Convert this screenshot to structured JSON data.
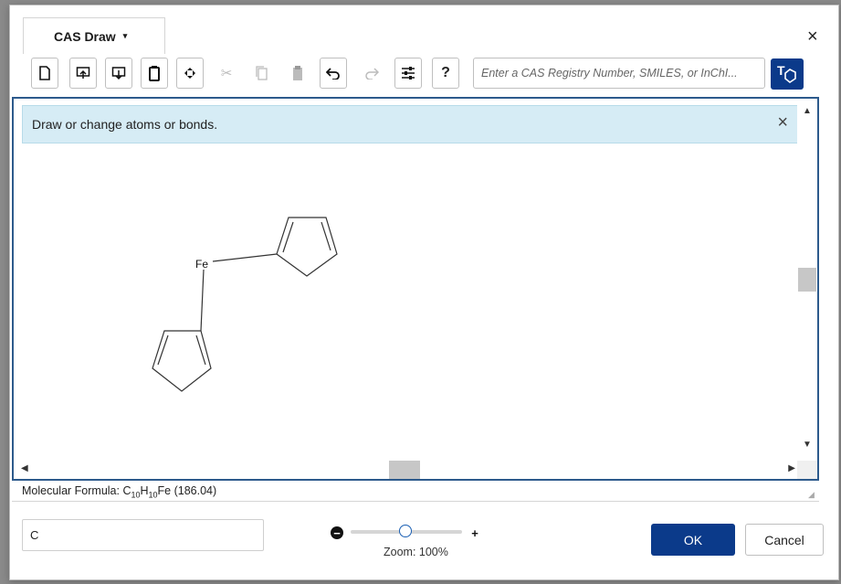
{
  "tab": {
    "label": "CAS Draw",
    "caret": "▾"
  },
  "close_glyph": "×",
  "toolbar": {
    "buttons": [
      {
        "icon": "new-document-icon",
        "glyph": "🗋",
        "disabled": false
      },
      {
        "icon": "import-icon",
        "glyph": "⇪",
        "disabled": false
      },
      {
        "icon": "export-icon",
        "glyph": "⇩",
        "disabled": false
      },
      {
        "icon": "clear-icon",
        "glyph": "▮",
        "disabled": false
      },
      {
        "icon": "select-icon",
        "glyph": "⁘",
        "disabled": false
      },
      {
        "icon": "cut-icon",
        "glyph": "✂",
        "disabled": true
      },
      {
        "icon": "copy-icon",
        "glyph": "⎘",
        "disabled": true
      },
      {
        "icon": "paste-icon",
        "glyph": "📋",
        "disabled": true
      },
      {
        "icon": "undo-icon",
        "glyph": "↶",
        "disabled": false
      },
      {
        "icon": "redo-icon",
        "glyph": "↷",
        "disabled": true
      },
      {
        "icon": "settings-icon",
        "glyph": "☰",
        "disabled": false
      },
      {
        "icon": "help-icon",
        "glyph": "?",
        "disabled": false
      }
    ],
    "search_placeholder": "Enter a CAS Registry Number, SMILES, or InChI...",
    "text_tool_label": "T"
  },
  "banner": {
    "message": "Draw or change atoms or bonds.",
    "close_glyph": "×"
  },
  "structure": {
    "atom_label": "Fe"
  },
  "formula": {
    "prefix": "Molecular Formula: C",
    "c_count": "10",
    "h": "H",
    "h_count": "10",
    "suffix": "Fe (186.04)"
  },
  "bottom": {
    "input_value": "C",
    "zoom_label": "Zoom: 100%",
    "zoom_level": 0.5,
    "ok_label": "OK",
    "cancel_label": "Cancel"
  },
  "colors": {
    "primary": "#0b3a8a",
    "banner_bg": "#d6ecf5",
    "canvas_border": "#2d5a8c"
  }
}
